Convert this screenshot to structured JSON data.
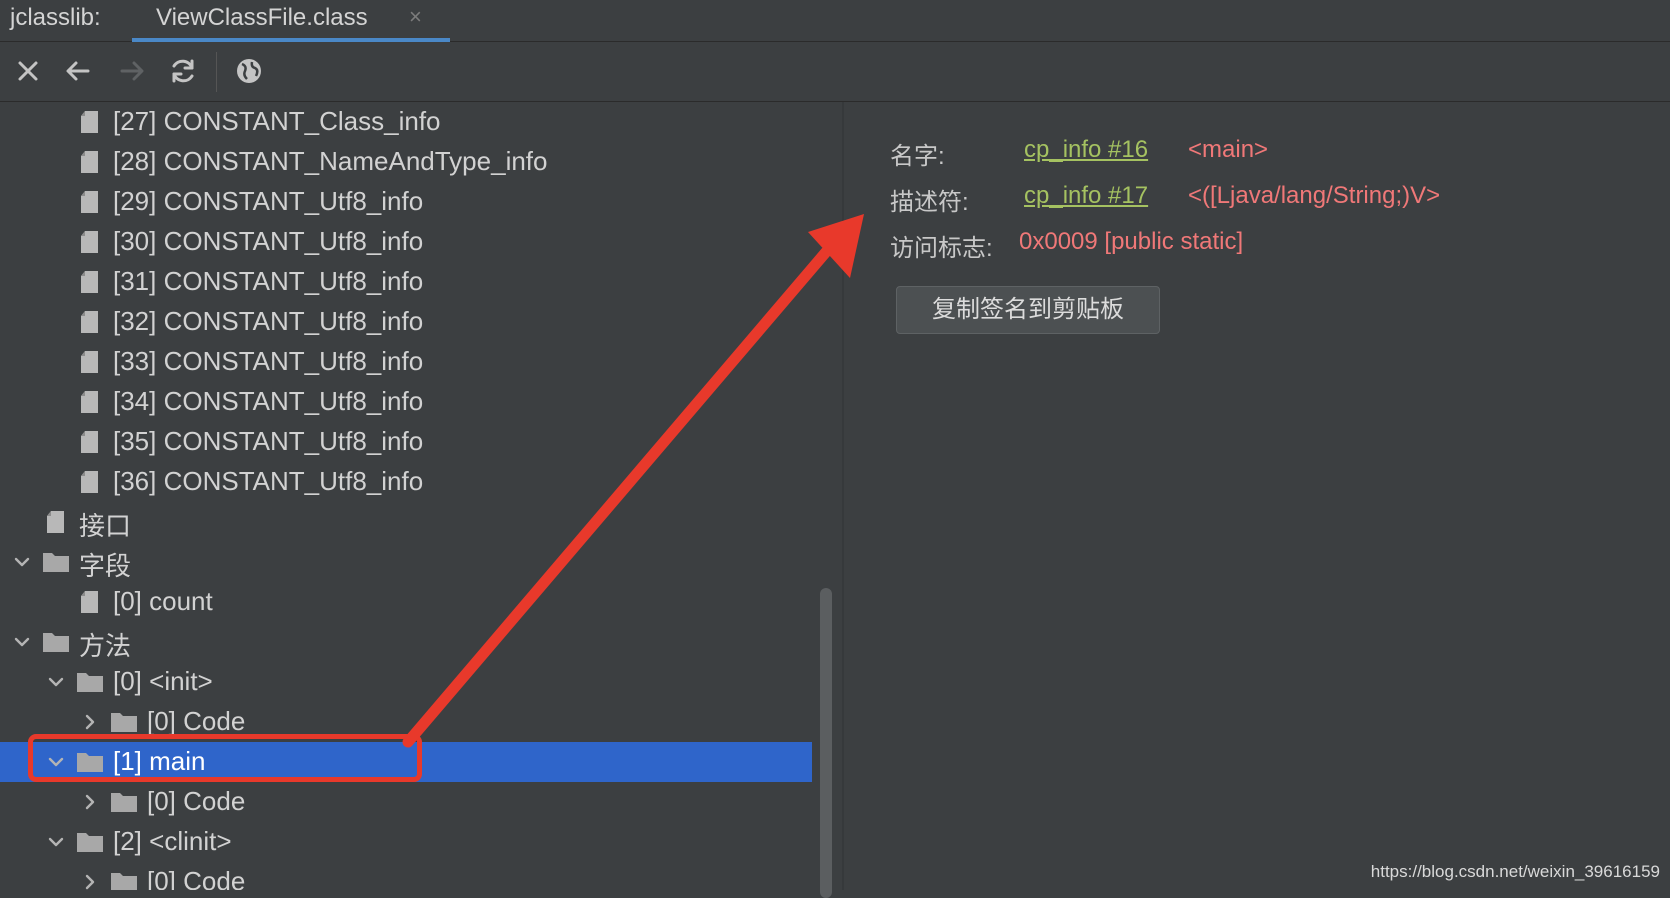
{
  "tabbar": {
    "prefix": "jclasslib:",
    "tab_label": "ViewClassFile.class",
    "close_glyph": "×"
  },
  "toolbar": {
    "buttons": [
      {
        "name": "close",
        "icon": "close-icon",
        "enabled": true
      },
      {
        "name": "back",
        "icon": "arrow-left-icon",
        "enabled": true
      },
      {
        "name": "forward",
        "icon": "arrow-right-icon",
        "enabled": false
      },
      {
        "name": "refresh",
        "icon": "refresh-icon",
        "enabled": true
      },
      {
        "name": "web",
        "icon": "globe-icon",
        "enabled": true
      }
    ]
  },
  "tree": {
    "rows": [
      {
        "label": "[27] CONSTANT_Class_info",
        "depth": 2,
        "icon": "file-icon",
        "chevron": "none"
      },
      {
        "label": "[28] CONSTANT_NameAndType_info",
        "depth": 2,
        "icon": "file-icon",
        "chevron": "none"
      },
      {
        "label": "[29] CONSTANT_Utf8_info",
        "depth": 2,
        "icon": "file-icon",
        "chevron": "none"
      },
      {
        "label": "[30] CONSTANT_Utf8_info",
        "depth": 2,
        "icon": "file-icon",
        "chevron": "none"
      },
      {
        "label": "[31] CONSTANT_Utf8_info",
        "depth": 2,
        "icon": "file-icon",
        "chevron": "none"
      },
      {
        "label": "[32] CONSTANT_Utf8_info",
        "depth": 2,
        "icon": "file-icon",
        "chevron": "none"
      },
      {
        "label": "[33] CONSTANT_Utf8_info",
        "depth": 2,
        "icon": "file-icon",
        "chevron": "none"
      },
      {
        "label": "[34] CONSTANT_Utf8_info",
        "depth": 2,
        "icon": "file-icon",
        "chevron": "none"
      },
      {
        "label": "[35] CONSTANT_Utf8_info",
        "depth": 2,
        "icon": "file-icon",
        "chevron": "none"
      },
      {
        "label": "[36] CONSTANT_Utf8_info",
        "depth": 2,
        "icon": "file-icon",
        "chevron": "none"
      },
      {
        "label": "接口",
        "depth": 1,
        "icon": "file-icon",
        "chevron": "none"
      },
      {
        "label": "字段",
        "depth": 1,
        "icon": "folder-icon",
        "chevron": "down"
      },
      {
        "label": "[0] count",
        "depth": 2,
        "icon": "file-icon",
        "chevron": "none"
      },
      {
        "label": "方法",
        "depth": 1,
        "icon": "folder-icon",
        "chevron": "down"
      },
      {
        "label": "[0] <init>",
        "depth": 2,
        "icon": "folder-icon",
        "chevron": "down"
      },
      {
        "label": "[0] Code",
        "depth": 3,
        "icon": "folder-icon",
        "chevron": "right"
      },
      {
        "label": "[1] main",
        "depth": 2,
        "icon": "folder-icon",
        "chevron": "down",
        "selected": true
      },
      {
        "label": "[0] Code",
        "depth": 3,
        "icon": "folder-icon",
        "chevron": "right"
      },
      {
        "label": "[2] <clinit>",
        "depth": 2,
        "icon": "folder-icon",
        "chevron": "down"
      },
      {
        "label": "[0] Code",
        "depth": 3,
        "icon": "folder-icon",
        "chevron": "right"
      }
    ]
  },
  "detail": {
    "name_label": "名字:",
    "name_link": "cp_info #16",
    "name_value": "<main>",
    "descriptor_label": "描述符:",
    "descriptor_link": "cp_info #17",
    "descriptor_value": "<([Ljava/lang/String;)V>",
    "access_label": "访问标志:",
    "access_value": "0x0009 [public static]",
    "copy_button_label": "复制签名到剪贴板"
  },
  "watermark": "https://blog.csdn.net/weixin_39616159",
  "colors": {
    "background": "#3c3f41",
    "selection": "#2f65ca",
    "link": "#a5c261",
    "value": "#f07878",
    "annotation": "#e8392b",
    "tab_underline": "#4a88c7"
  }
}
